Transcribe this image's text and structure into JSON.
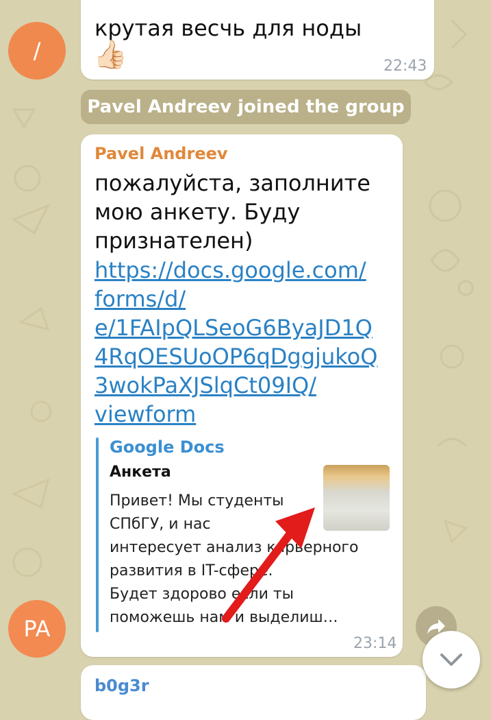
{
  "colors": {
    "wallpaper": "#d9d2ae",
    "bubble": "#ffffff",
    "link": "#2a81c4",
    "avatar_top": "#f0894e",
    "avatar_pa": "#f28a52",
    "sender_pavel": "#e0883a",
    "sender_b0g3r": "#4a8bd0",
    "preview_site": "#3a8fd3",
    "arrow": "#e21b1b"
  },
  "messages": {
    "top": {
      "avatar_initials": "/",
      "text": "крутая весчь для ноды",
      "emoji": "👍🏻",
      "time": "22:43"
    },
    "service": {
      "text": "Pavel Andreev joined the group"
    },
    "main": {
      "avatar_initials": "PA",
      "sender": "Pavel Andreev",
      "text": "пожалуйста, заполните\nмою анкету. Буду\nпризнателен)",
      "link": "https://docs.google.com/\nforms/d/\ne/1FAIpQLSeoG6ByaJD1Q\n4RqOESUoOP6qDggjukoQ\n3wokPaXJSlqCt09IQ/\nviewform",
      "preview": {
        "site": "Google Docs",
        "title": "Анкета",
        "description": "Привет! Мы студенты\nСПбГУ, и нас\nинтересует анализ карьерного\nразвития  в IT-сфере.\nБудет здорово если ты\nпоможешь нам и выделиш…"
      },
      "time": "23:14"
    },
    "next": {
      "sender": "b0g3r"
    }
  },
  "icons": {
    "share": "share-icon",
    "scroll_down": "chevron-down-icon",
    "annotation": "red-arrow"
  }
}
